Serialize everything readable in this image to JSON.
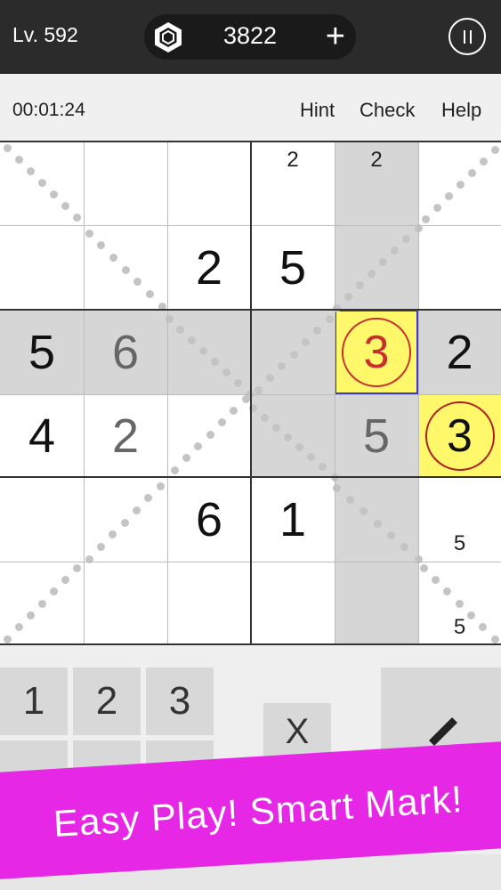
{
  "header": {
    "level_label": "Lv. 592",
    "coins": "3822",
    "add_coins_symbol": "+",
    "coin_icon": "hexagon-coin-icon",
    "pause_icon": "pause-icon"
  },
  "toolbar": {
    "timer": "00:01:24",
    "hint": "Hint",
    "check": "Check",
    "help": "Help"
  },
  "board": {
    "rows": 6,
    "cols": 6,
    "cells": [
      {
        "r": 0,
        "c": 3,
        "small": "2"
      },
      {
        "r": 0,
        "c": 4,
        "small": "2",
        "shade": true
      },
      {
        "r": 1,
        "c": 2,
        "big": "2"
      },
      {
        "r": 1,
        "c": 3,
        "big": "5"
      },
      {
        "r": 1,
        "c": 4,
        "shade": true
      },
      {
        "r": 2,
        "c": 0,
        "big": "5",
        "shade": true
      },
      {
        "r": 2,
        "c": 1,
        "big": "6",
        "shade": true,
        "gray": true
      },
      {
        "r": 2,
        "c": 2,
        "shade": true
      },
      {
        "r": 2,
        "c": 3,
        "shade": true
      },
      {
        "r": 2,
        "c": 4,
        "circle": "3",
        "yellow": true,
        "selected": true
      },
      {
        "r": 2,
        "c": 5,
        "big": "2",
        "shade": true
      },
      {
        "r": 3,
        "c": 0,
        "big": "4"
      },
      {
        "r": 3,
        "c": 1,
        "big": "2",
        "gray": true
      },
      {
        "r": 3,
        "c": 3,
        "shade": true
      },
      {
        "r": 3,
        "c": 4,
        "big": "5",
        "shade": true,
        "gray": true
      },
      {
        "r": 3,
        "c": 5,
        "circle": "3",
        "yellow": true,
        "dark": true
      },
      {
        "r": 4,
        "c": 2,
        "big": "6"
      },
      {
        "r": 4,
        "c": 3,
        "big": "1"
      },
      {
        "r": 4,
        "c": 4,
        "shade": true
      },
      {
        "r": 4,
        "c": 5,
        "small": "5",
        "bottom": true
      },
      {
        "r": 5,
        "c": 4,
        "shade": true
      },
      {
        "r": 5,
        "c": 5,
        "small": "5",
        "bottom": true
      }
    ]
  },
  "keypad": {
    "keys": [
      "1",
      "2",
      "3"
    ],
    "erase": "X",
    "mark_icon": "pencil-icon"
  },
  "banner": {
    "text": "Easy Play! Smart Mark!",
    "color": "#e628e6"
  }
}
